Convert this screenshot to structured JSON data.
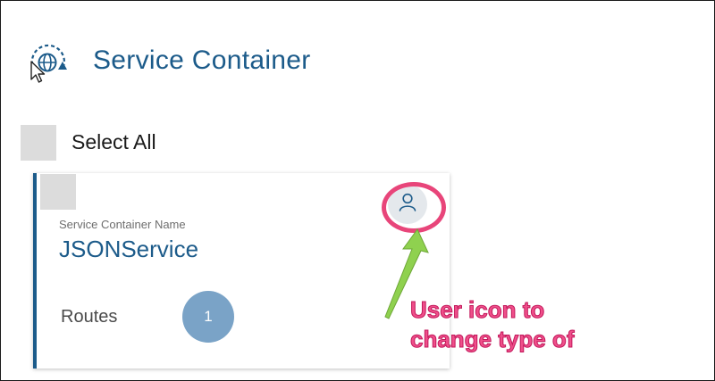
{
  "header": {
    "icon": "globe-refresh-icon",
    "title": "Service Container"
  },
  "select_all": {
    "label": "Select All",
    "checked": false
  },
  "card": {
    "checked": false,
    "field_label": "Service Container Name",
    "name": "JSONService",
    "routes_label": "Routes",
    "routes_count": "1",
    "type_icon": "user-icon"
  },
  "annotation": {
    "line1": "User icon to",
    "line2": "change type of",
    "ring_color": "#e8457a",
    "arrow_color": "#8fd14f",
    "text_color": "#ef4f8a"
  },
  "colors": {
    "primary": "#1c5b8a",
    "badge": "#7aa3c7",
    "checkbox": "#dcdcdc"
  }
}
